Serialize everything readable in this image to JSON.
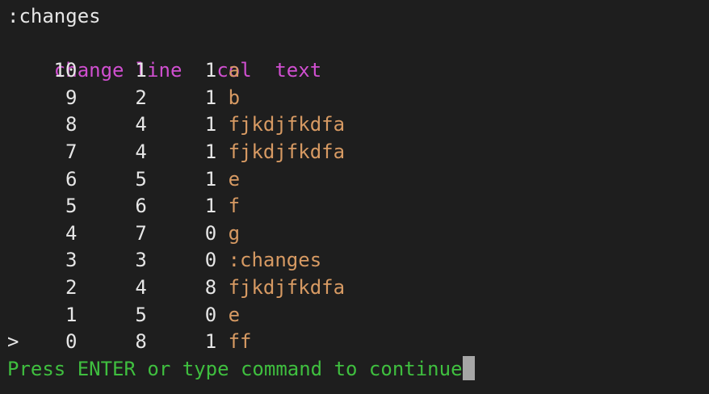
{
  "command_line": ":changes",
  "header": {
    "change": "change",
    "line": "line",
    "col": "col",
    "text": "text"
  },
  "rows": [
    {
      "marker": "",
      "change": "10",
      "line": "1",
      "col": "1",
      "text": "a"
    },
    {
      "marker": "",
      "change": "9",
      "line": "2",
      "col": "1",
      "text": "b"
    },
    {
      "marker": "",
      "change": "8",
      "line": "4",
      "col": "1",
      "text": "fjkdjfkdfa"
    },
    {
      "marker": "",
      "change": "7",
      "line": "4",
      "col": "1",
      "text": "fjkdjfkdfa"
    },
    {
      "marker": "",
      "change": "6",
      "line": "5",
      "col": "1",
      "text": "e"
    },
    {
      "marker": "",
      "change": "5",
      "line": "6",
      "col": "1",
      "text": "f"
    },
    {
      "marker": "",
      "change": "4",
      "line": "7",
      "col": "0",
      "text": "g"
    },
    {
      "marker": "",
      "change": "3",
      "line": "3",
      "col": "0",
      "text": ":changes"
    },
    {
      "marker": "",
      "change": "2",
      "line": "4",
      "col": "8",
      "text": "fjkdjfkdfa"
    },
    {
      "marker": "",
      "change": "1",
      "line": "5",
      "col": "0",
      "text": "e"
    },
    {
      "marker": ">",
      "change": "0",
      "line": "8",
      "col": "1",
      "text": "ff"
    }
  ],
  "prompt": "Press ENTER or type command to continue",
  "colors": {
    "background": "#1e1e1e",
    "header": "#d04fd0",
    "text_column": "#d79a63",
    "prompt": "#3fbf3f",
    "cursor": "#a6a6a6"
  }
}
